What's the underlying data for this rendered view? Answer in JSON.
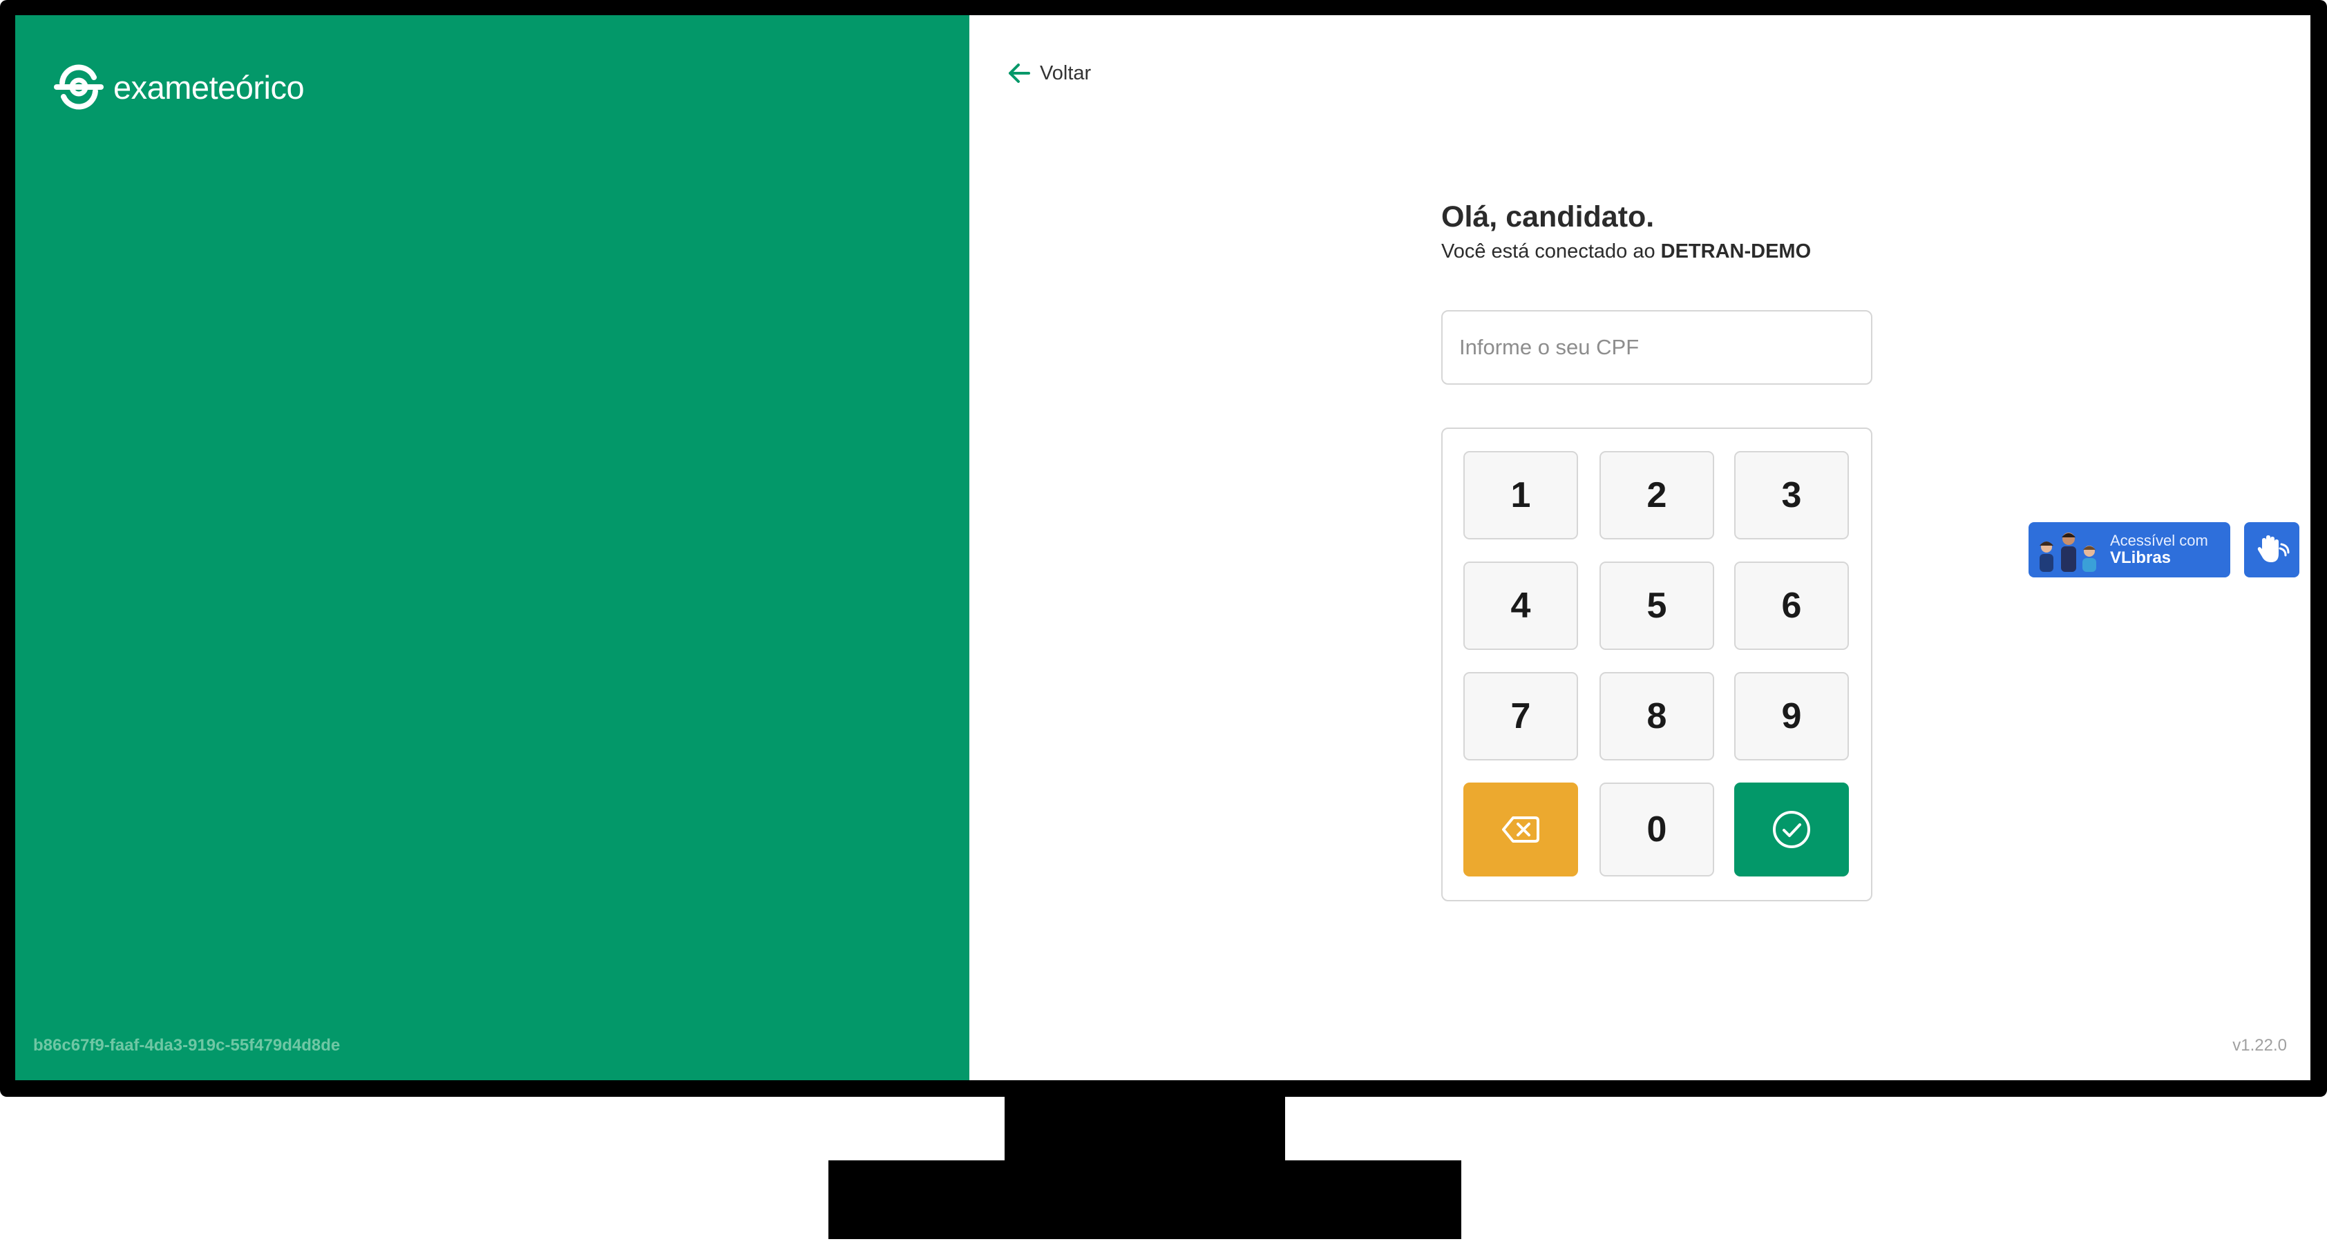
{
  "brand": {
    "logo_text": "exameteórico",
    "session_id": "b86c67f9-faaf-4da3-919c-55f479d4d8de"
  },
  "nav": {
    "back_label": "Voltar"
  },
  "login": {
    "greeting": "Olá, candidato.",
    "connected_prefix": "Você está conectado ao ",
    "connected_org": "DETRAN-DEMO",
    "cpf_placeholder": "Informe o seu CPF",
    "cpf_value": ""
  },
  "keypad": {
    "keys": [
      "1",
      "2",
      "3",
      "4",
      "5",
      "6",
      "7",
      "8",
      "9",
      "0"
    ],
    "backspace_icon": "backspace-icon",
    "confirm_icon": "check-circle-icon"
  },
  "vlibras": {
    "line1": "Acessível com",
    "line2": "VLibras",
    "hand_icon": "sign-language-hand-icon"
  },
  "footer": {
    "version": "v1.22.0"
  },
  "colors": {
    "brand_green": "#039869",
    "backspace_orange": "#eca92f",
    "vlibras_blue": "#2e6fdb",
    "session_id_text": "#6fc7a4"
  }
}
